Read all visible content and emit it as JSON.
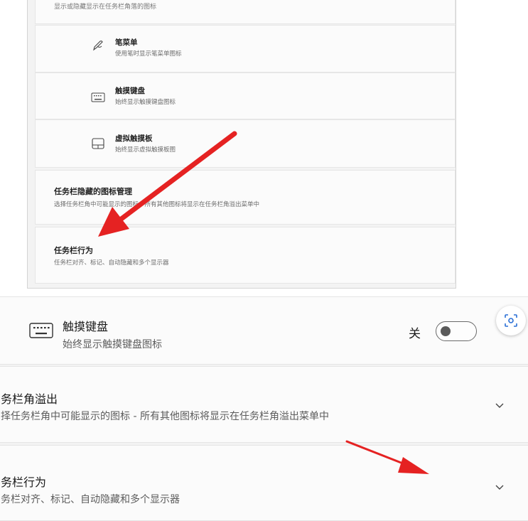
{
  "top": {
    "hint": "显示或隐藏显示在任务栏角落的图标",
    "items": [
      {
        "title": "笔菜单",
        "desc": "使用笔时显示笔菜单图标",
        "icon": "pen-icon"
      },
      {
        "title": "触摸键盘",
        "desc": "始终显示触摸键盘图标",
        "icon": "keyboard-icon"
      },
      {
        "title": "虚拟触摸板",
        "desc": "始终显示虚拟触摸板图",
        "icon": "touchpad-icon"
      }
    ],
    "sections": [
      {
        "title": "任务栏隐藏的图标管理",
        "desc": "选择任务栏角中可能显示的图标 - 所有其他图标将显示在任务栏角溢出菜单中"
      },
      {
        "title": "任务栏行为",
        "desc": "任务栏对齐、标记、自动隐藏和多个显示器"
      }
    ]
  },
  "bottom": {
    "keyboard": {
      "title": "触摸键盘",
      "desc": "始终显示触摸键盘图标",
      "state_label": "关",
      "toggle_on": false,
      "icon": "keyboard-icon"
    },
    "sections": [
      {
        "title": "务栏角溢出",
        "desc": "择任务栏角中可能显示的图标 - 所有其他图标将显示在任务栏角溢出菜单中",
        "icon": "chevron-down-icon"
      },
      {
        "title": "务栏行为",
        "desc": "务栏对齐、标记、自动隐藏和多个显示器",
        "icon": "chevron-down-icon"
      }
    ],
    "lens_icon": "visual-search-icon"
  },
  "colors": {
    "arrow": "#e52222",
    "panel_bg": "#f3f3f3",
    "card_bg": "#fbfbfb"
  }
}
